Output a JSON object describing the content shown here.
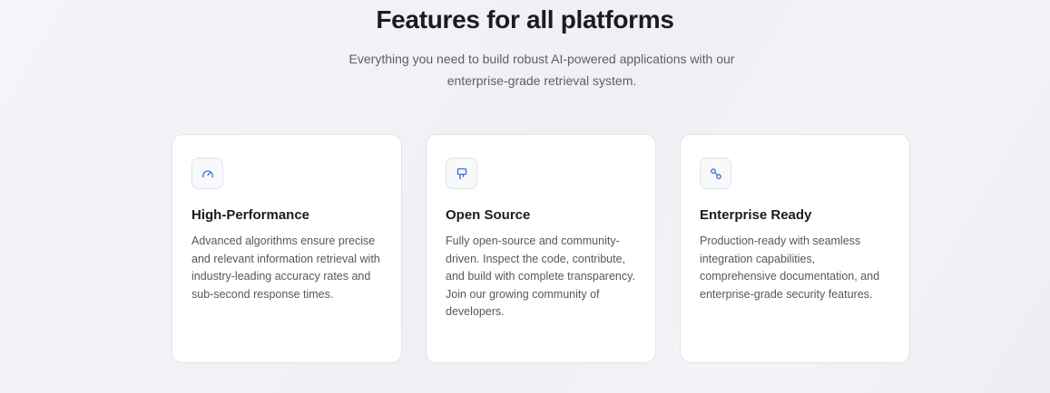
{
  "section": {
    "title": "Features for all platforms",
    "subtitle": "Everything you need to build robust AI-powered applications with our enterprise-grade retrieval system."
  },
  "colors": {
    "accent": "#3b6fd4",
    "card_border": "#e2e4e9",
    "background": "#f1f2f5"
  },
  "features": [
    {
      "icon": "gauge-icon",
      "title": "High-Performance",
      "description": "Advanced algorithms ensure precise and relevant information retrieval with industry-leading accuracy rates and sub-second response times."
    },
    {
      "icon": "open-source-icon",
      "title": "Open Source",
      "description": "Fully open-source and community-driven. Inspect the code, contribute, and build with complete transparency. Join our growing community of developers."
    },
    {
      "icon": "integration-icon",
      "title": "Enterprise Ready",
      "description": "Production-ready with seamless integration capabilities, comprehensive documentation, and enterprise-grade security features."
    }
  ]
}
